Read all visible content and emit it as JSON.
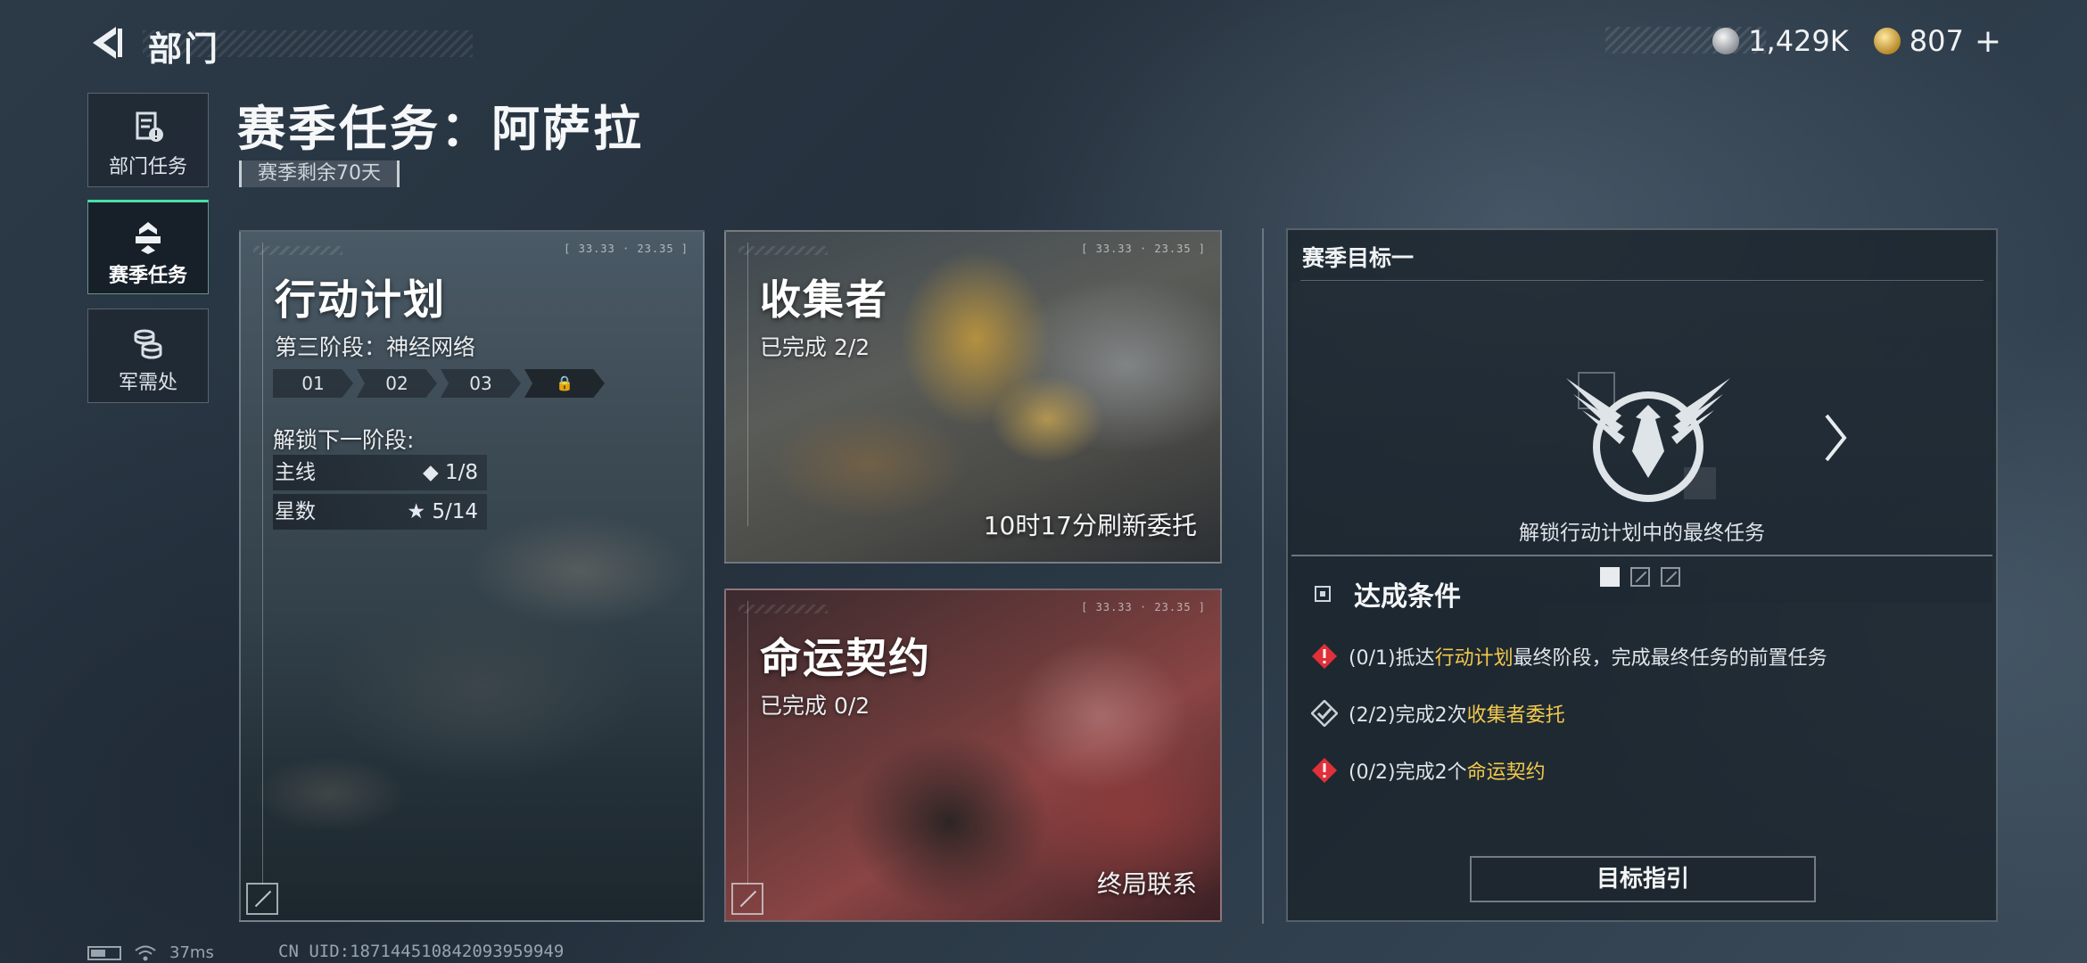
{
  "header": {
    "title": "部门",
    "currency": [
      {
        "icon": "silver-coin-icon",
        "value": "1,429K"
      },
      {
        "icon": "gold-coin-icon",
        "value": "807"
      }
    ],
    "plus": "+"
  },
  "sidebar": {
    "items": [
      {
        "label": "部门任务",
        "icon": "document-alert-icon"
      },
      {
        "label": "赛季任务",
        "icon": "badge-icon"
      },
      {
        "label": "军需处",
        "icon": "coins-icon"
      }
    ]
  },
  "page": {
    "title": "赛季任务：阿萨拉",
    "season_left": "赛季剩余70天"
  },
  "cards": {
    "ops": {
      "title": "行动计划",
      "phase": "第三阶段：神经网络",
      "stages": [
        "01",
        "02",
        "03"
      ],
      "unlock_label": "解锁下一阶段:",
      "requirements": [
        {
          "label": "主线",
          "value": "◆ 1/8"
        },
        {
          "label": "星数",
          "value": "★ 5/14"
        }
      ],
      "coords": "[ 33.33 · 23.35 ]"
    },
    "collector": {
      "title": "收集者",
      "progress": "已完成 2/2",
      "refresh": "10时17分刷新委托",
      "coords": "[ 33.33 · 23.35 ]"
    },
    "fate": {
      "title": "命运契约",
      "progress": "已完成 0/2",
      "footer": "终局联系",
      "coords": "[ 33.33 · 23.35 ]"
    }
  },
  "goal": {
    "header": "赛季目标一",
    "description": "解锁行动计划中的最终任务",
    "conditions_title": "达成条件",
    "conditions": [
      {
        "status": "incomplete",
        "prefix": "(0/1)抵达",
        "highlight": "行动计划",
        "suffix": "最终阶段，完成最终任务的前置任务"
      },
      {
        "status": "complete",
        "prefix": "(2/2)完成2次",
        "highlight": "收集者委托",
        "suffix": ""
      },
      {
        "status": "incomplete",
        "prefix": "(0/2)完成2个",
        "highlight": "命运契约",
        "suffix": ""
      }
    ],
    "guide_button": "目标指引",
    "accent_color": "#f2c94c",
    "alert_color": "#e0303a"
  },
  "status_bar": {
    "ping": "37ms",
    "uid": "CN UID:18714451084209395994​9"
  }
}
